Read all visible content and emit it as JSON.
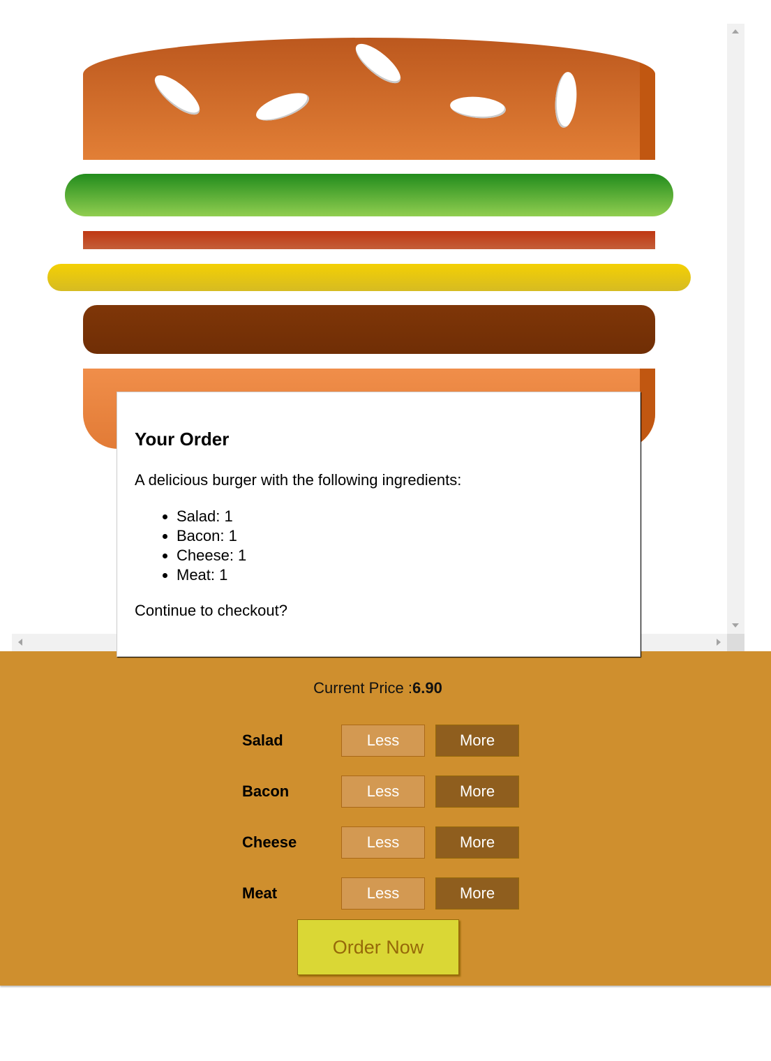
{
  "order_modal": {
    "title": "Your Order",
    "intro": "A delicious burger with the following ingredients:",
    "ingredients": [
      {
        "label": "Salad: 1"
      },
      {
        "label": "Bacon: 1"
      },
      {
        "label": "Cheese: 1"
      },
      {
        "label": "Meat: 1"
      }
    ],
    "question": "Continue to checkout?"
  },
  "controls": {
    "price_label": "Current Price :",
    "price_value": "6.90",
    "rows": [
      {
        "label": "Salad",
        "less": "Less",
        "more": "More"
      },
      {
        "label": "Bacon",
        "less": "Less",
        "more": "More"
      },
      {
        "label": "Cheese",
        "less": "Less",
        "more": "More"
      },
      {
        "label": "Meat",
        "less": "Less",
        "more": "More"
      }
    ],
    "order_button": "Order Now"
  },
  "colors": {
    "controls_bg": "#cf8f2e",
    "less_bg": "#d39952",
    "more_bg": "#8f5e1e",
    "order_bg": "#dad735",
    "order_text": "#966909"
  }
}
